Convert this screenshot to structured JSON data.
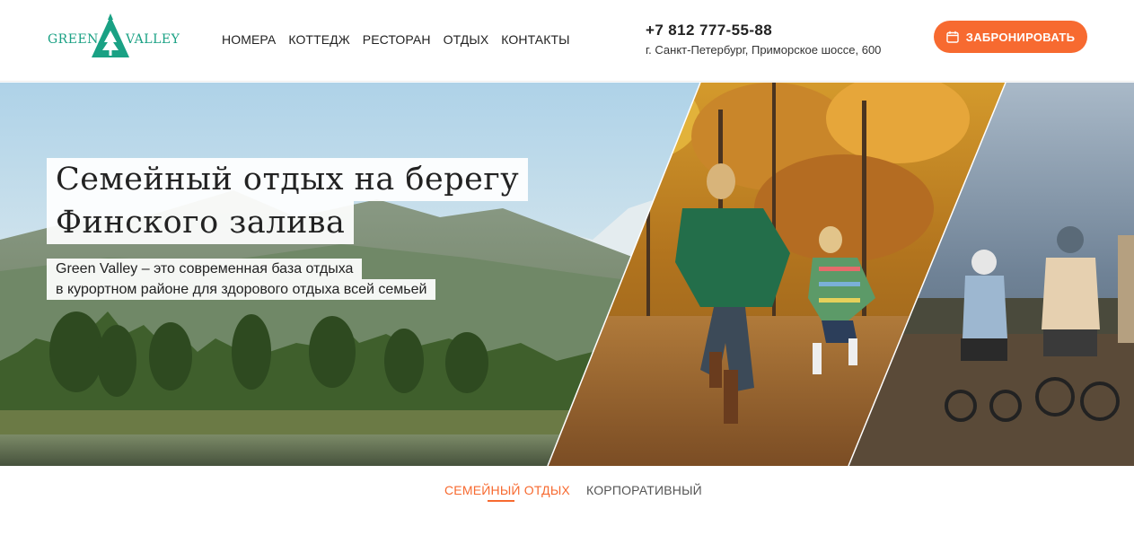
{
  "logo": {
    "word1": "GREEN",
    "word2": "VALLEY",
    "icon": "pine-tree-triangle-icon",
    "color": "#1aa184"
  },
  "nav": {
    "items": [
      {
        "label": "НОМЕРА"
      },
      {
        "label": "КОТТЕДЖ"
      },
      {
        "label": "РЕСТОРАН"
      },
      {
        "label": "ОТДЫХ"
      },
      {
        "label": "КОНТАКТЫ"
      }
    ]
  },
  "contact": {
    "phone": "+7 812 777-55-88",
    "address": "г. Санкт-Петербург, Приморское шоссе, 600"
  },
  "booking": {
    "label": "ЗАБРОНИРОВАТЬ",
    "icon": "calendar-icon",
    "color": "#f76a30"
  },
  "hero": {
    "title_line1": "Семейный отдых на берегу",
    "title_line2": "Финского залива",
    "subtitle_line1": "Green Valley – это современная база отдыха",
    "subtitle_line2": "в курортном районе для здорового отдыха всей семьей"
  },
  "tabs": {
    "items": [
      {
        "label": "СЕМЕЙНЫЙ ОТДЫХ",
        "active": true
      },
      {
        "label": "КОРПОРАТИВНЫЙ",
        "active": false
      }
    ],
    "accent": "#f76a30"
  }
}
